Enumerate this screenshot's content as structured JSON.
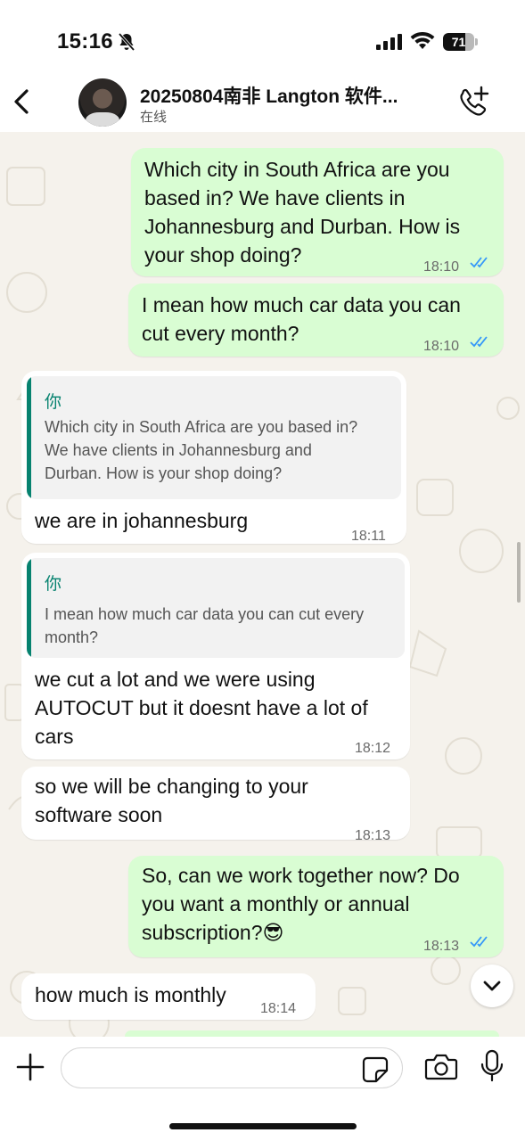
{
  "status_bar": {
    "time": "15:16",
    "battery": "71",
    "battery_level": 0.71
  },
  "header": {
    "contact_name": "20250804南非 Langton 软件...",
    "contact_status": "在线"
  },
  "messages": [
    {
      "direction": "outgoing",
      "lines": [
        "Which city in South Africa are you",
        "based in? We have clients in",
        "Johannesburg and Durban. How is",
        "your shop doing?"
      ],
      "time": "18:10",
      "read": true
    },
    {
      "direction": "outgoing",
      "lines": [
        "I mean how much car data you can",
        "cut every month?"
      ],
      "time": "18:10",
      "read": true
    },
    {
      "direction": "incoming",
      "quote": {
        "author": "你",
        "lines": [
          "Which city in South Africa are you based in?",
          "We have clients in Johannesburg and",
          "Durban. How is your shop doing?"
        ]
      },
      "lines": [
        "we are in johannesburg"
      ],
      "time": "18:11"
    },
    {
      "direction": "incoming",
      "quote": {
        "author": "你",
        "lines": [
          "I mean how much car data you can cut every",
          "month?"
        ]
      },
      "lines": [
        "we cut a lot and we were using",
        "AUTOCUT but it doesnt have a lot of",
        "cars"
      ],
      "time": "18:12"
    },
    {
      "direction": "incoming",
      "lines": [
        "so we will be changing to your",
        "software soon"
      ],
      "time": "18:13"
    },
    {
      "direction": "outgoing",
      "lines": [
        "So, can we work together now? Do",
        "you want a monthly or annual",
        "subscription?😎"
      ],
      "time": "18:13",
      "read": true
    },
    {
      "direction": "incoming",
      "lines": [
        "how much is monthly"
      ],
      "time": "18:14"
    }
  ],
  "composer": {
    "value": "",
    "placeholder": ""
  },
  "icons": {
    "back": "chevron-left-icon",
    "call": "phone-plus-icon",
    "attach": "plus-icon",
    "sticker": "sticker-icon",
    "camera": "camera-icon",
    "mic": "microphone-icon",
    "scroll": "chevron-down-icon"
  },
  "colors": {
    "outgoing_bubble": "#d9fdd3",
    "incoming_bubble": "#ffffff",
    "quote_accent": "#06826f",
    "read_ticks": "#3497f9",
    "chat_background": "#f5f2ec"
  }
}
